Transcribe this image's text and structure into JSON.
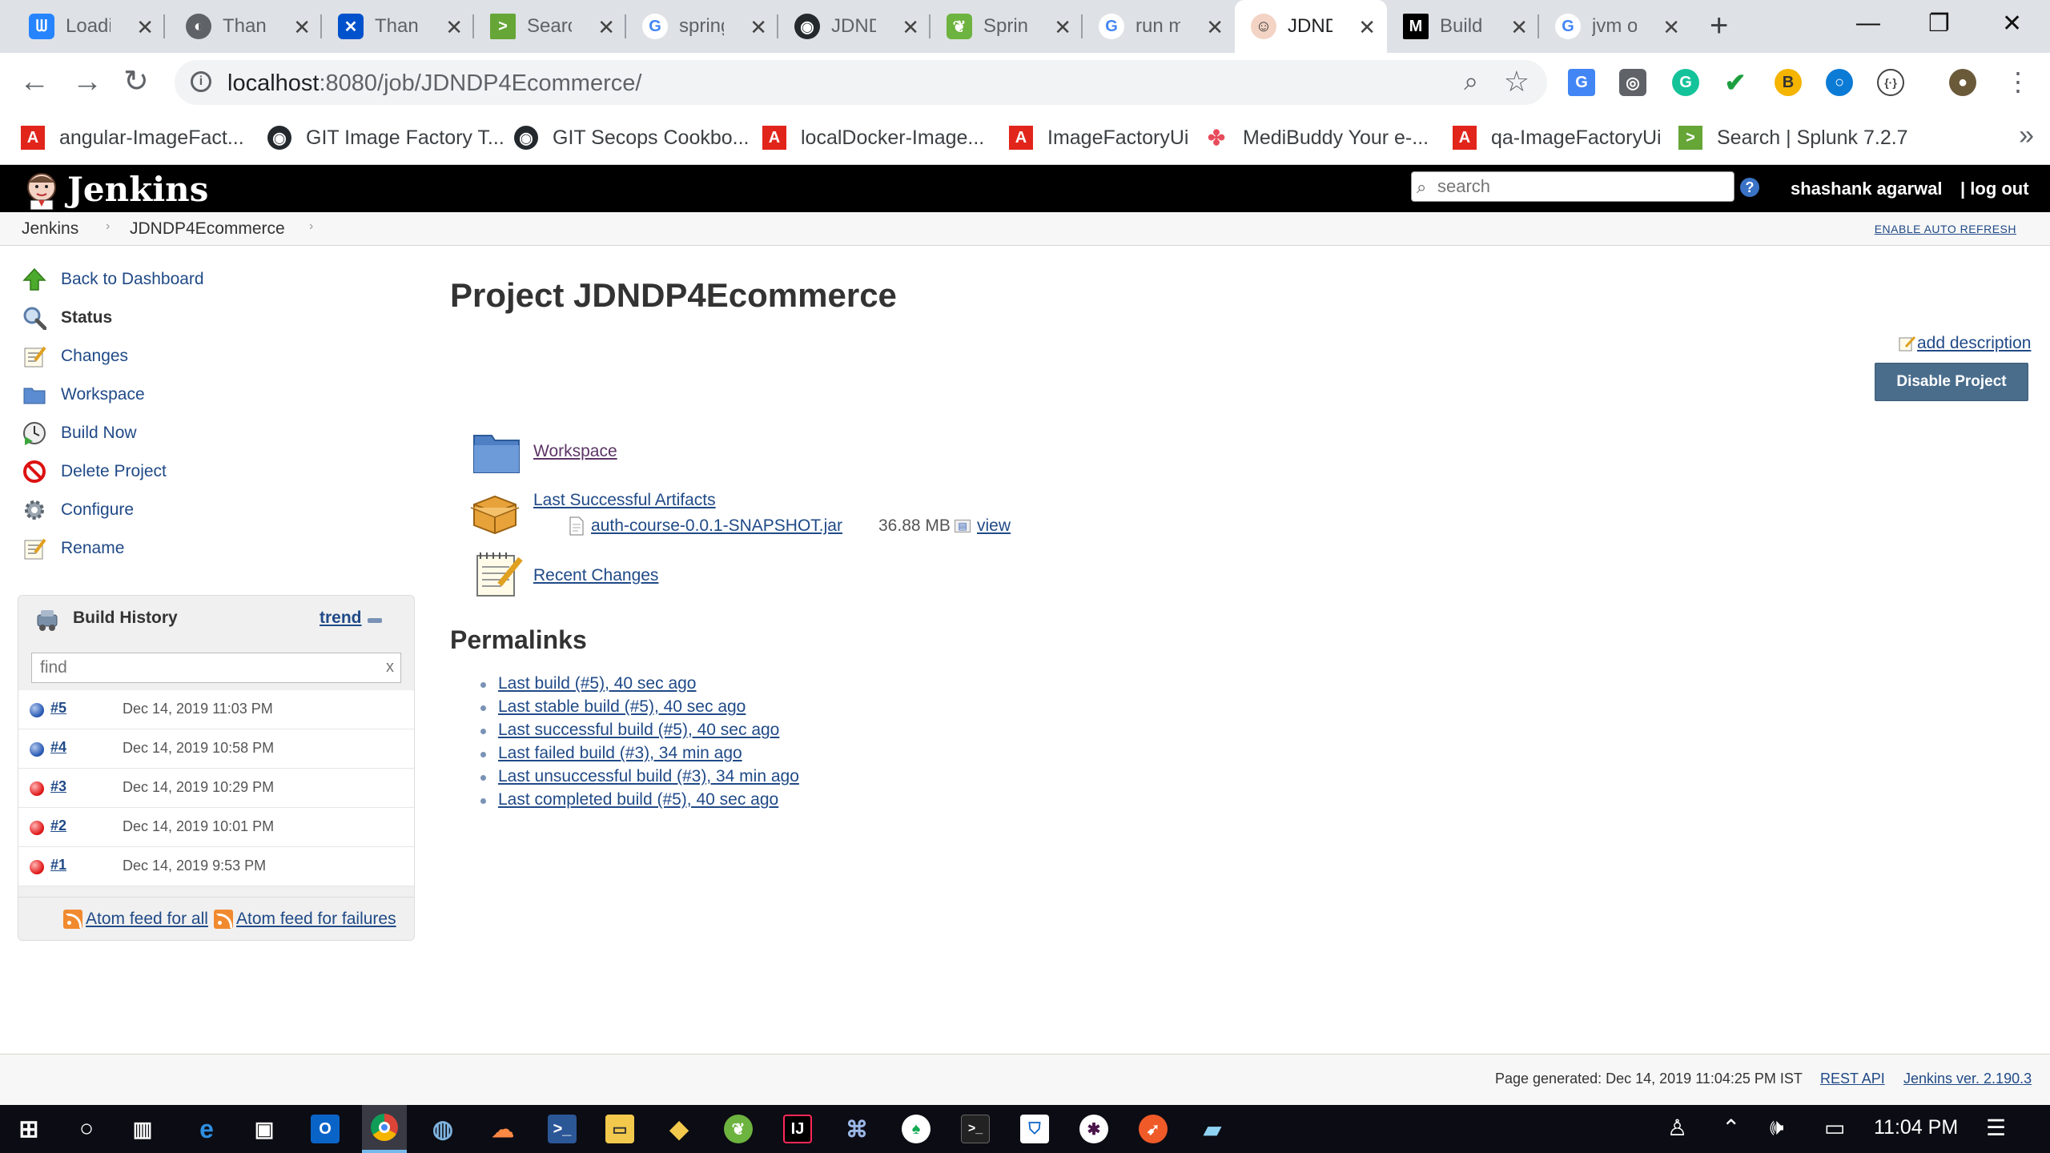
{
  "browser": {
    "tabs": [
      {
        "title": "Loading",
        "icon": "confluence-icon",
        "color": "#2684ff"
      },
      {
        "title": "Thank you",
        "icon": "globe-icon",
        "color": "#5f6368"
      },
      {
        "title": "Thank you",
        "icon": "confluence-icon",
        "color": "#0052cc"
      },
      {
        "title": "Search",
        "icon": "splunk-icon",
        "color": "#65a637"
      },
      {
        "title": "spring",
        "icon": "google-icon",
        "color": "#4285f4"
      },
      {
        "title": "JDND",
        "icon": "github-icon",
        "color": "#24292e"
      },
      {
        "title": "Spring",
        "icon": "spring-icon",
        "color": "#6db33f"
      },
      {
        "title": "run m",
        "icon": "google-icon",
        "color": "#4285f4"
      },
      {
        "title": "JDND",
        "icon": "jenkins-icon",
        "color": "#d33833"
      },
      {
        "title": "Build",
        "icon": "medium-icon",
        "color": "#000000"
      },
      {
        "title": "jvm o",
        "icon": "google-icon",
        "color": "#4285f4"
      }
    ],
    "active_tab": 8,
    "url_host": "localhost",
    "url_path": ":8080/job/JDNDP4Ecommerce/",
    "bookmarks": [
      {
        "label": "angular-ImageFact...",
        "icon": "adobe-icon",
        "color": "#e1251b"
      },
      {
        "label": "GIT Image Factory T...",
        "icon": "github-icon",
        "color": "#24292e"
      },
      {
        "label": "GIT Secops Cookbo...",
        "icon": "github-icon",
        "color": "#24292e"
      },
      {
        "label": "localDocker-Image...",
        "icon": "adobe-icon",
        "color": "#e1251b"
      },
      {
        "label": "ImageFactoryUi",
        "icon": "adobe-icon",
        "color": "#e1251b"
      },
      {
        "label": "MediBuddy Your e-...",
        "icon": "medibuddy-icon",
        "color": "#e84c5c"
      },
      {
        "label": "qa-ImageFactoryUi",
        "icon": "adobe-icon",
        "color": "#e1251b"
      },
      {
        "label": "Search | Splunk 7.2.7",
        "icon": "splunk-icon",
        "color": "#65a637"
      }
    ]
  },
  "jenkins": {
    "brand": "Jenkins",
    "search_placeholder": "search",
    "user": "shashank agarwal",
    "logout": "| log out",
    "breadcrumbs": [
      "Jenkins",
      "JDNDP4Ecommerce"
    ],
    "auto_refresh": "ENABLE AUTO REFRESH",
    "tasks": [
      {
        "label": "Back to Dashboard",
        "icon": "up-arrow-icon"
      },
      {
        "label": "Status",
        "icon": "magnifier-icon"
      },
      {
        "label": "Changes",
        "icon": "notepad-icon"
      },
      {
        "label": "Workspace",
        "icon": "folder-icon"
      },
      {
        "label": "Build Now",
        "icon": "clock-play-icon"
      },
      {
        "label": "Delete Project",
        "icon": "no-entry-icon"
      },
      {
        "label": "Configure",
        "icon": "gear-icon"
      },
      {
        "label": "Rename",
        "icon": "notepad-icon"
      }
    ],
    "build_history": {
      "title": "Build History",
      "trend": "trend",
      "find_placeholder": "find",
      "clear": "x",
      "builds": [
        {
          "number": "#5",
          "date": "Dec 14, 2019 11:03 PM",
          "status": "blue"
        },
        {
          "number": "#4",
          "date": "Dec 14, 2019 10:58 PM",
          "status": "blue"
        },
        {
          "number": "#3",
          "date": "Dec 14, 2019 10:29 PM",
          "status": "red"
        },
        {
          "number": "#2",
          "date": "Dec 14, 2019 10:01 PM",
          "status": "red"
        },
        {
          "number": "#1",
          "date": "Dec 14, 2019 9:53 PM",
          "status": "red"
        }
      ],
      "feed_all": "Atom feed for all",
      "feed_failures": "Atom feed for failures"
    },
    "main": {
      "title": "Project JDNDP4Ecommerce",
      "add_description": "add description",
      "disable_button": "Disable Project",
      "workspace": "Workspace",
      "last_artifacts": "Last Successful Artifacts",
      "artifact_name": "auth-course-0.0.1-SNAPSHOT.jar",
      "artifact_size": "36.88 MB",
      "artifact_view": "view",
      "recent_changes": "Recent Changes",
      "permalinks_title": "Permalinks",
      "permalinks": [
        "Last build (#5), 40 sec ago",
        "Last stable build (#5), 40 sec ago",
        "Last successful build (#5), 40 sec ago",
        "Last failed build (#3), 34 min ago",
        "Last unsuccessful build (#3), 34 min ago",
        "Last completed build (#5), 40 sec ago"
      ]
    },
    "footer": {
      "generated": "Page generated: Dec 14, 2019 11:04:25 PM IST",
      "rest_api": "REST API",
      "version": "Jenkins ver. 2.190.3"
    }
  },
  "taskbar": {
    "time": "11:04 PM"
  }
}
